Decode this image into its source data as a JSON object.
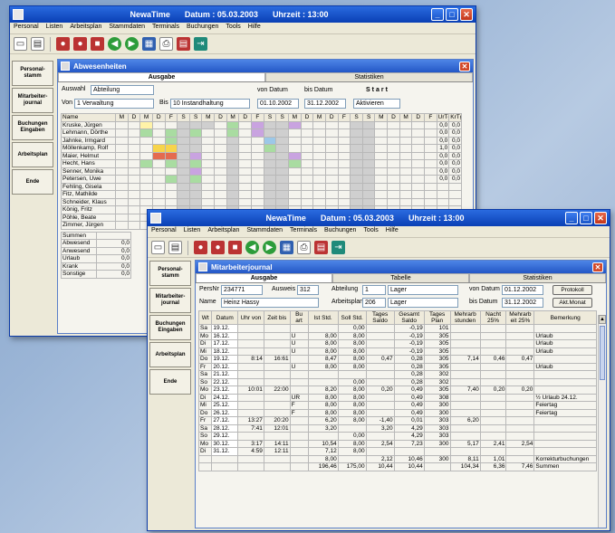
{
  "app_title": "NewaTime",
  "date_label": "Datum : 05.03.2003",
  "time_label": "Uhrzeit : 13:00",
  "window_buttons": {
    "minimize": "_",
    "maximize": "□",
    "close": "✕"
  },
  "menu": [
    "Personal",
    "Listen",
    "Arbeitsplan",
    "Stammdaten",
    "Terminals",
    "Buchungen",
    "Tools",
    "Hilfe"
  ],
  "sidebar": [
    "Personal-stamm",
    "Mitarbeiter-journal",
    "Buchungen Eingaben",
    "Arbeitsplan",
    "Ende"
  ],
  "back": {
    "child_title": "Abwesenheiten",
    "tabs": [
      "Ausgabe",
      "Statistiken"
    ],
    "auswahl_label": "Auswahl",
    "auswahl_value": "Abteilung",
    "von_label": "Von",
    "von_value": "1 Verwaltung",
    "bis_label": "Bis",
    "bis_value": "10 Instandhaltung",
    "von_datum_label": "von Datum",
    "von_datum_value": "01.10.2002",
    "bis_datum_label": "bis Datum",
    "bis_datum_value": "31.12.2002",
    "start_label": "Start",
    "start_value": "Aktivieren",
    "name_header": "Name",
    "stat_headers": [
      "UrTg",
      "KrTg"
    ],
    "day_headers": [
      "M",
      "D",
      "M",
      "D",
      "F",
      "S",
      "S",
      "M",
      "D",
      "M",
      "D",
      "F",
      "S",
      "S",
      "M",
      "D",
      "M",
      "D",
      "F",
      "S",
      "S",
      "M",
      "D",
      "M",
      "D",
      "F"
    ],
    "rows": [
      {
        "name": "Kruske, Jürgen",
        "ur": "0,0",
        "kr": "0,0"
      },
      {
        "name": "Lehmann, Dörthe",
        "ur": "0,0",
        "kr": "0,0"
      },
      {
        "name": "Jahnke, Irmgard",
        "ur": "0,0",
        "kr": "0,0"
      },
      {
        "name": "Möllenkamp, Rolf",
        "ur": "1,0",
        "kr": "0,0"
      },
      {
        "name": "Maier, Helmut",
        "ur": "0,0",
        "kr": "0,0"
      },
      {
        "name": "Hecht, Hans",
        "ur": "0,0",
        "kr": "0,0"
      },
      {
        "name": "Senner, Monika",
        "ur": "0,0",
        "kr": "0,0"
      },
      {
        "name": "Petersen, Uwe",
        "ur": "0,0",
        "kr": "0,0"
      },
      {
        "name": "Fehling, Gisela",
        "ur": "",
        "kr": ""
      },
      {
        "name": "Fitz, Mathilde",
        "ur": "",
        "kr": ""
      },
      {
        "name": "Schneider, Klaus",
        "ur": "",
        "kr": ""
      },
      {
        "name": "König, Fritz",
        "ur": "",
        "kr": ""
      },
      {
        "name": "Pöhle, Beate",
        "ur": "",
        "kr": ""
      },
      {
        "name": "Zimmer, Jürgen",
        "ur": "",
        "kr": ""
      }
    ],
    "summary": [
      {
        "label": "Summen",
        "val": ""
      },
      {
        "label": "Abwesend",
        "val": "0,0"
      },
      {
        "label": "Anwesend",
        "val": "0,0"
      },
      {
        "label": "Urlaub",
        "val": "0,0"
      },
      {
        "label": "Krank",
        "val": "0,0"
      },
      {
        "label": "Sonstige",
        "val": "0,0"
      }
    ]
  },
  "front": {
    "child_title": "Mitarbeiterjournal",
    "tabs": [
      "Ausgabe",
      "Tabelle",
      "Statistiken"
    ],
    "persnr_label": "PersNr",
    "persnr_value": "234771",
    "ausweis_label": "Ausweis",
    "ausweis_value": "312",
    "name_label": "Name",
    "name_value": "Heinz Hassy",
    "abteilung_label": "Abteilung",
    "abteilung_value": "1",
    "abteilung_name": "Lager",
    "arbeitsplan_label": "Arbeitsplan",
    "arbeitsplan_value": "206",
    "arbeitsplan_name": "Lager",
    "von_datum_label": "von Datum",
    "von_datum_value": "01.12.2002",
    "bis_datum_label": "bis Datum",
    "bis_datum_value": "31.12.2002",
    "btn_print": "Protokoll",
    "btn_month": "Akt.Monat",
    "headers": [
      "Wt",
      "Datum",
      "Uhr von",
      "Zeit bis",
      "Bu art",
      "Ist Std.",
      "Soll Std.",
      "Tages Saldo",
      "Gesamt Saldo",
      "Tages Plan",
      "Mehrarb stunden",
      "Nacht 25%",
      "Mehrarb eit 25%",
      "Bemerkung"
    ],
    "rows": [
      [
        "Sa",
        "19.12.",
        "",
        "",
        "",
        "",
        "0,00",
        "",
        "-0,19",
        "101",
        "",
        "",
        "",
        ""
      ],
      [
        "Mo",
        "16.12.",
        "",
        "",
        "U",
        "8,00",
        "8,00",
        "",
        "-0,19",
        "305",
        "",
        "",
        "",
        "Urlaub"
      ],
      [
        "Di",
        "17.12.",
        "",
        "",
        "U",
        "8,00",
        "8,00",
        "",
        "-0,19",
        "305",
        "",
        "",
        "",
        "Urlaub"
      ],
      [
        "Mi",
        "18.12.",
        "",
        "",
        "U",
        "8,00",
        "8,00",
        "",
        "-0,19",
        "305",
        "",
        "",
        "",
        "Urlaub"
      ],
      [
        "Do",
        "19.12.",
        "8:14",
        "16:61",
        "",
        "8,47",
        "8,00",
        "0,47",
        "0,28",
        "305",
        "7,14",
        "0,46",
        "0,47",
        ""
      ],
      [
        "Fr",
        "20.12.",
        "",
        "",
        "U",
        "8,00",
        "8,00",
        "",
        "0,28",
        "305",
        "",
        "",
        "",
        "Urlaub"
      ],
      [
        "Sa",
        "21.12.",
        "",
        "",
        "",
        "",
        "",
        "",
        "0,28",
        "302",
        "",
        "",
        "",
        ""
      ],
      [
        "So",
        "22.12.",
        "",
        "",
        "",
        "",
        "0,00",
        "",
        "0,28",
        "302",
        "",
        "",
        "",
        ""
      ],
      [
        "Mo",
        "23.12.",
        "10:01",
        "22:00",
        "",
        "8,20",
        "8,00",
        "0,20",
        "0,49",
        "305",
        "7,40",
        "0,20",
        "0,20",
        ""
      ],
      [
        "Di",
        "24.12.",
        "",
        "",
        "UR",
        "8,00",
        "8,00",
        "",
        "0,49",
        "308",
        "",
        "",
        "",
        "½ Urlaub 24.12."
      ],
      [
        "Mi",
        "25.12.",
        "",
        "",
        "F",
        "8,00",
        "8,00",
        "",
        "0,49",
        "300",
        "",
        "",
        "",
        "Feiertag"
      ],
      [
        "Do",
        "26.12.",
        "",
        "",
        "F",
        "8,00",
        "8,00",
        "",
        "0,49",
        "300",
        "",
        "",
        "",
        "Feiertag"
      ],
      [
        "Fr",
        "27.12.",
        "13:27",
        "20:20",
        "",
        "6,20",
        "8,00",
        "-1,40",
        "0,01",
        "303",
        "6,20",
        "",
        "",
        ""
      ],
      [
        "Sa",
        "28.12.",
        "7:41",
        "12:01",
        "",
        "3,20",
        "",
        "3,20",
        "4,29",
        "303",
        "",
        "",
        "",
        ""
      ],
      [
        "So",
        "29.12.",
        "",
        "",
        "",
        "",
        "0,00",
        "",
        "4,29",
        "303",
        "",
        "",
        "",
        ""
      ],
      [
        "Mo",
        "30.12.",
        "3:17",
        "14:11",
        "",
        "10,54",
        "8,00",
        "2,54",
        "7,23",
        "300",
        "5,17",
        "2,41",
        "2,54",
        ""
      ],
      [
        "Di",
        "31.12.",
        "4:59",
        "12:11",
        "",
        "7,12",
        "8,00",
        "",
        "",
        "",
        "",
        "",
        "",
        ""
      ],
      [
        "",
        "",
        "",
        "",
        "",
        "8,00",
        "",
        "2,12",
        "10,46",
        "300",
        "8,11",
        "1,01",
        "",
        "Korrekturbuchungen"
      ],
      [
        "",
        "",
        "",
        "",
        "",
        "196,46",
        "175,00",
        "10,44",
        "10,44",
        "",
        "104,34",
        "6,36",
        "7,46",
        "Summen"
      ]
    ]
  }
}
